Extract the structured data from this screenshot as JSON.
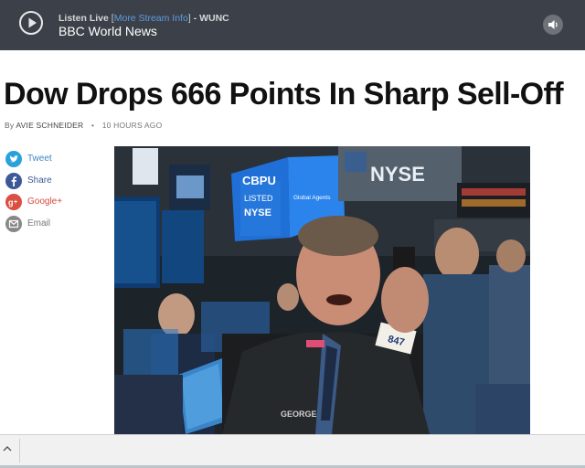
{
  "player": {
    "listen_prefix": "Listen Live",
    "bracket_open": "[",
    "stream_link": "More Stream Info",
    "bracket_close": "]",
    "station_suffix": " - WUNC",
    "station_name": "BBC World News"
  },
  "article": {
    "headline": "Dow Drops 666 Points In Sharp Sell-Off",
    "byline_prefix": "By",
    "author": "AVIE SCHNEIDER",
    "separator": "•",
    "time_ago": "10 HOURS AGO"
  },
  "share": [
    {
      "label": "Tweet",
      "icon": "twitter-icon",
      "color": "#2ba1d9"
    },
    {
      "label": "Share",
      "icon": "facebook-icon",
      "color": "#3b5998"
    },
    {
      "label": "Google+",
      "icon": "google-plus-icon",
      "color": "#dc4e41"
    },
    {
      "label": "Email",
      "icon": "email-icon",
      "color": "#888888"
    }
  ],
  "photo": {
    "signs": [
      "NYSE",
      "CBPU",
      "LISTED",
      "NYSE",
      "Global Agents"
    ],
    "badge_number": "847",
    "jacket_name": "GEORGE"
  },
  "colors": {
    "player_bg": "#3c4149",
    "link_blue": "#5d9be0"
  }
}
